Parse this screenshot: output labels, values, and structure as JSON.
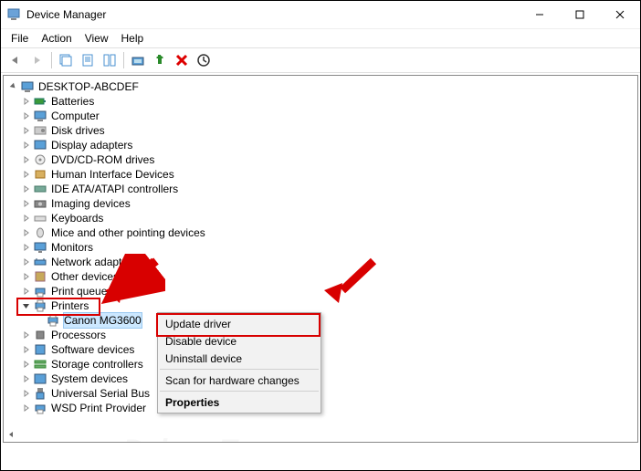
{
  "window": {
    "title": "Device Manager"
  },
  "menubar": {
    "items": [
      "File",
      "Action",
      "View",
      "Help"
    ]
  },
  "rootNode": {
    "label": "DESKTOP-ABCDEF"
  },
  "tree": [
    {
      "label": "Batteries",
      "icon": "battery"
    },
    {
      "label": "Computer",
      "icon": "computer"
    },
    {
      "label": "Disk drives",
      "icon": "disk"
    },
    {
      "label": "Display adapters",
      "icon": "display"
    },
    {
      "label": "DVD/CD-ROM drives",
      "icon": "cdrom"
    },
    {
      "label": "Human Interface Devices",
      "icon": "hid"
    },
    {
      "label": "IDE ATA/ATAPI controllers",
      "icon": "ide"
    },
    {
      "label": "Imaging devices",
      "icon": "imaging"
    },
    {
      "label": "Keyboards",
      "icon": "keyboard"
    },
    {
      "label": "Mice and other pointing devices",
      "icon": "mouse"
    },
    {
      "label": "Monitors",
      "icon": "monitor"
    },
    {
      "label": "Network adapters",
      "icon": "network"
    },
    {
      "label": "Other devices",
      "icon": "other"
    },
    {
      "label": "Print queues",
      "icon": "printq"
    }
  ],
  "printers": {
    "label": "Printers",
    "child": "Canon MG3600"
  },
  "tree2": [
    {
      "label": "Processors",
      "icon": "cpu"
    },
    {
      "label": "Software devices",
      "icon": "software"
    },
    {
      "label": "Storage controllers",
      "icon": "storage"
    },
    {
      "label": "System devices",
      "icon": "system"
    },
    {
      "label": "Universal Serial Bus",
      "icon": "usb"
    },
    {
      "label": "WSD Print Provider",
      "icon": "wsd"
    }
  ],
  "context_menu": {
    "items": [
      "Update driver",
      "Disable device",
      "Uninstall device",
      "Scan for hardware changes",
      "Properties"
    ]
  },
  "watermark": "DriverEasy.com"
}
